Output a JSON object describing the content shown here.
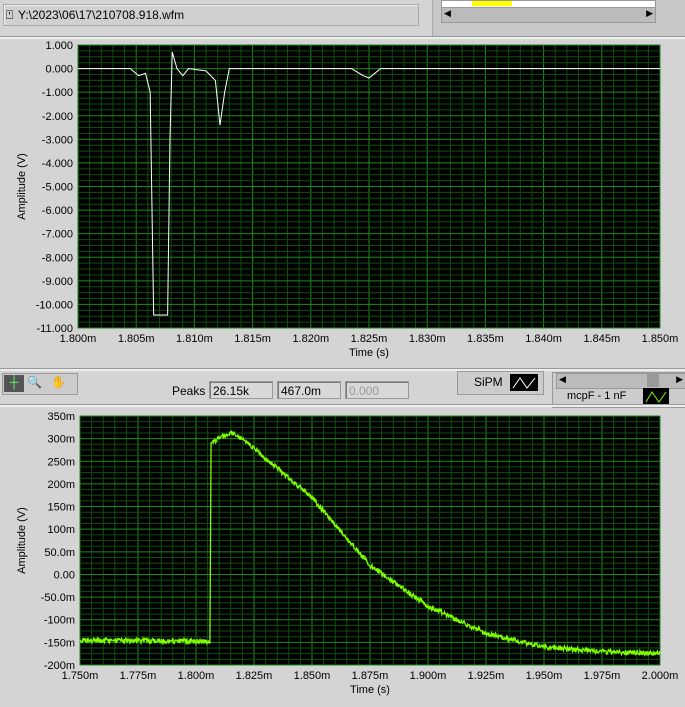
{
  "file_path": "Y:\\2023\\06\\17\\210708.918.wfm",
  "toolbar": {
    "icons": [
      "cursor-icon",
      "zoom-icon",
      "pan-hand-icon"
    ]
  },
  "peaks": {
    "label": "Peaks",
    "values": [
      "26.15k",
      "467.0m",
      "0.000"
    ]
  },
  "legend": {
    "sipm": "SiPM",
    "mcp": "mcpF - 1 nF"
  },
  "colors": {
    "top_trace": "#ffffff",
    "bottom_trace": "#7fff00",
    "grid_major": "#1e8a1e",
    "grid_minor": "#0f4d0f",
    "plot_bg": "#000000"
  },
  "chart_data": [
    {
      "type": "line",
      "xlabel": "Time (s)",
      "ylabel": "Amplitude (V)",
      "xticks": [
        "1.800m",
        "1.805m",
        "1.810m",
        "1.815m",
        "1.820m",
        "1.825m",
        "1.830m",
        "1.835m",
        "1.840m",
        "1.845m",
        "1.850m"
      ],
      "yticks": [
        "1.000",
        "0.000",
        "-1.000",
        "-2.000",
        "-3.000",
        "-4.000",
        "-5.000",
        "-6.000",
        "-7.000",
        "-8.000",
        "-9.000",
        "-10.000",
        "-11.000"
      ],
      "xlim": [
        1.8,
        1.85
      ],
      "ylim": [
        -11,
        1
      ],
      "x": [
        1.8,
        1.8045,
        1.8052,
        1.8058,
        1.8062,
        1.8065,
        1.8077,
        1.8079,
        1.8081,
        1.8085,
        1.809,
        1.8095,
        1.811,
        1.8118,
        1.8122,
        1.8126,
        1.813,
        1.8235,
        1.8245,
        1.825,
        1.8255,
        1.826,
        1.85
      ],
      "y": [
        0,
        0,
        -0.3,
        -0.2,
        -1,
        -10.45,
        -10.45,
        -3,
        0.7,
        0,
        -0.3,
        0,
        -0.1,
        -0.5,
        -2.4,
        -1,
        0,
        0,
        -0.3,
        -0.4,
        -0.2,
        0,
        0
      ]
    },
    {
      "type": "line",
      "xlabel": "Time (s)",
      "ylabel": "Amplitude (V)",
      "xticks": [
        "1.750m",
        "1.775m",
        "1.800m",
        "1.825m",
        "1.850m",
        "1.875m",
        "1.900m",
        "1.925m",
        "1.950m",
        "1.975m",
        "2.000m"
      ],
      "yticks": [
        "350m",
        "300m",
        "250m",
        "200m",
        "150m",
        "100m",
        "50.0m",
        "0.00",
        "-50.0m",
        "-100m",
        "-150m",
        "-200m"
      ],
      "xlim": [
        1.75,
        2.0
      ],
      "ylim": [
        -200,
        350
      ],
      "x": [
        1.75,
        1.806,
        1.8065,
        1.815,
        1.82,
        1.85,
        1.875,
        1.9,
        1.925,
        1.95,
        1.975,
        2.0
      ],
      "y": [
        -145,
        -148,
        290,
        315,
        300,
        170,
        20,
        -70,
        -130,
        -160,
        -170,
        -175
      ]
    }
  ]
}
